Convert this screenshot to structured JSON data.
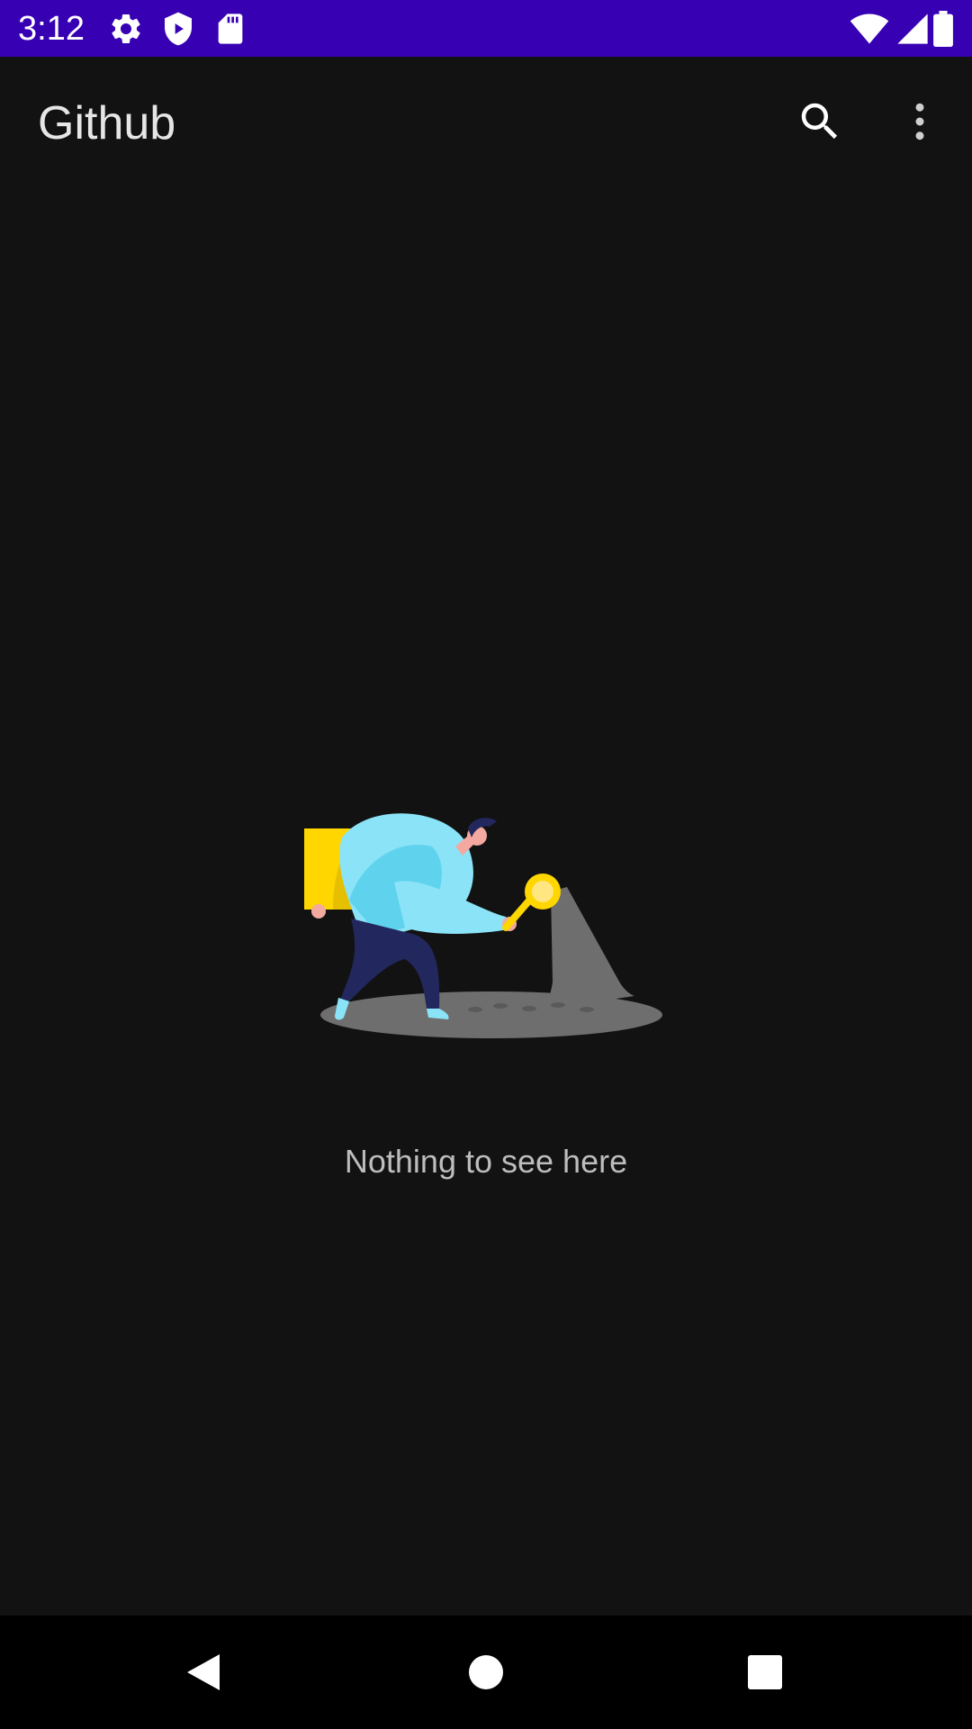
{
  "status_bar": {
    "time": "3:12",
    "background": "#3700b3",
    "left_icons": [
      "settings-icon",
      "play-protect-icon",
      "sd-card-icon"
    ],
    "right_icons": [
      "wifi-icon",
      "cell-signal-icon",
      "battery-icon"
    ]
  },
  "toolbar": {
    "title": "Github",
    "actions": [
      "search-icon",
      "more-options-icon"
    ]
  },
  "empty_state": {
    "illustration": "searching-person-illustration",
    "message": "Nothing to see here",
    "accent_colors": {
      "box": "#ffd600",
      "coat": "#8be3f7",
      "pants": "#22285e",
      "lens": "#ffd600",
      "shadow": "#6e6e6e"
    }
  },
  "nav_bar": {
    "buttons": [
      "back-icon",
      "home-icon",
      "recents-icon"
    ]
  }
}
